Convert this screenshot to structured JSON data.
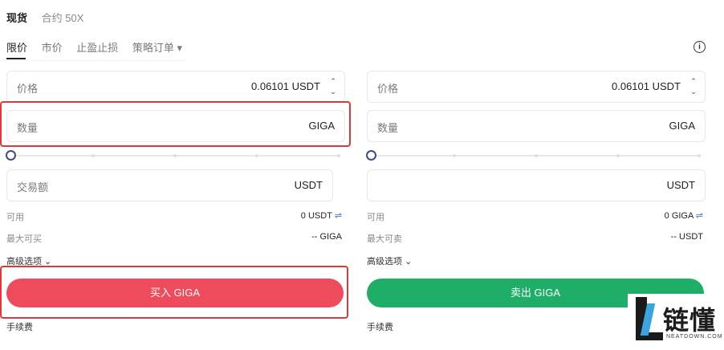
{
  "top_tabs": [
    "现货",
    "合约 50X"
  ],
  "order_tabs": [
    "限价",
    "市价",
    "止盈止损",
    "策略订单 ▾"
  ],
  "info_icon": "ⓘ",
  "buy": {
    "price_label": "价格",
    "price_value": "0.06101 USDT",
    "qty_label": "数量",
    "qty_unit": "GIGA",
    "amount_label": "交易额",
    "amount_unit": "USDT",
    "available_label": "可用",
    "available_value": "0 USDT",
    "max_label": "最大可买",
    "max_value": "-- GIGA",
    "advanced_label": "高级选项 ⌄",
    "button_label": "买入 GIGA",
    "fee_label": "手续费"
  },
  "sell": {
    "price_label": "价格",
    "price_value": "0.06101 USDT",
    "qty_label": "数量",
    "qty_unit": "GIGA",
    "amount_unit": "USDT",
    "available_label": "可用",
    "available_value": "0 GIGA",
    "max_label": "最大可卖",
    "max_value": "-- USDT",
    "advanced_label": "高级选项 ⌄",
    "button_label": "卖出 GIGA",
    "fee_label": "手续费"
  },
  "swap_icon": "⇌",
  "spinner": {
    "up": "⌃",
    "down": "⌄"
  },
  "watermark": {
    "title": "链懂",
    "subtitle": "NEATDOWN.COM"
  },
  "colors": {
    "buy": "#ee4b5d",
    "sell": "#1fae67",
    "highlight": "#d93a3a",
    "watermark_blue": "#3ba4e0"
  }
}
